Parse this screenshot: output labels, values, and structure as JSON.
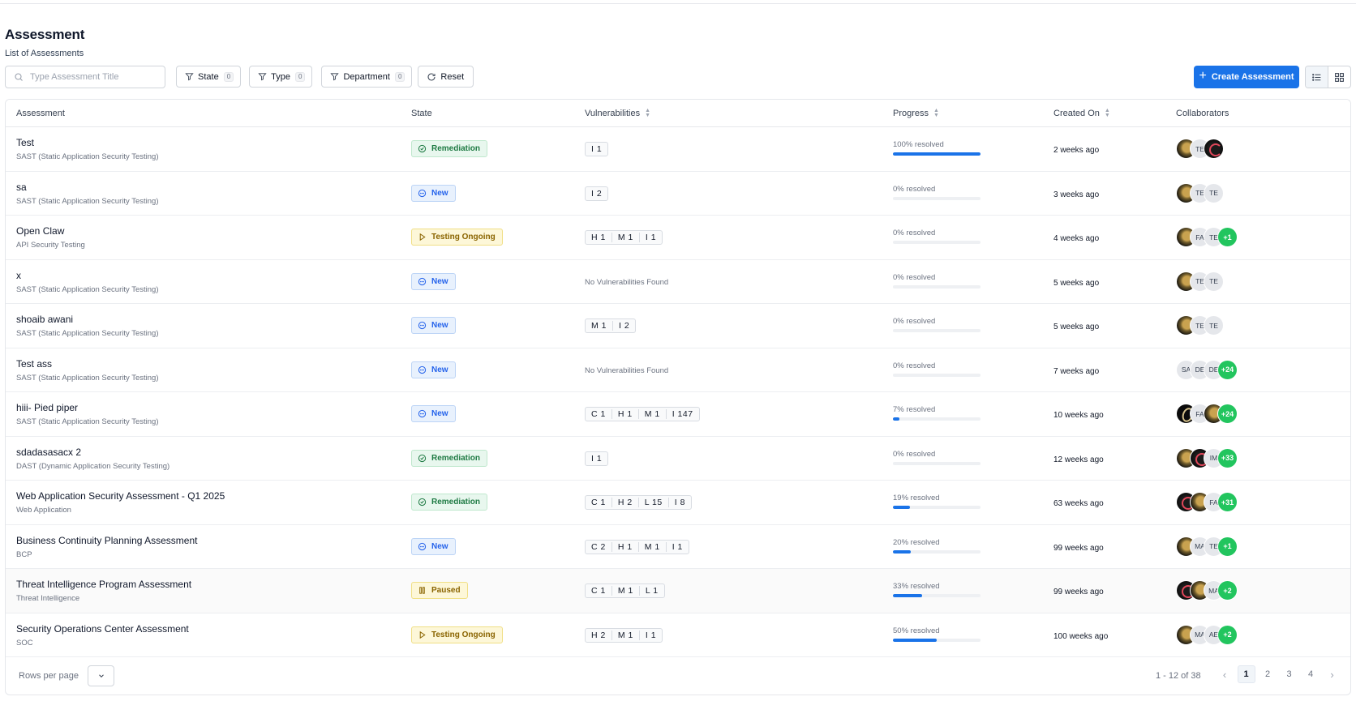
{
  "page": {
    "title": "Assessment",
    "subtitle": "List of Assessments"
  },
  "toolbar": {
    "search_placeholder": "Type Assessment Title",
    "filters": [
      {
        "label": "State",
        "count": "0"
      },
      {
        "label": "Type",
        "count": "0"
      },
      {
        "label": "Department",
        "count": "0"
      }
    ],
    "reset_label": "Reset",
    "create_label": "Create Assessment"
  },
  "table": {
    "columns": [
      "Assessment",
      "State",
      "Vulnerabilities",
      "Progress",
      "Created On",
      "Collaborators"
    ],
    "no_vulns_text": "No Vulnerabilities Found",
    "rows": [
      {
        "title": "Test",
        "type": "SAST (Static Application Security Testing)",
        "state": "Remediation",
        "vulns": [
          "I 1"
        ],
        "progress_label": "100% resolved",
        "progress": 100,
        "created": "2 weeks ago",
        "collaborators": [
          {
            "kind": "img1"
          },
          {
            "kind": "ini",
            "text": "TE"
          },
          {
            "kind": "img2"
          }
        ]
      },
      {
        "title": "sa",
        "type": "SAST (Static Application Security Testing)",
        "state": "New",
        "vulns": [
          "I 2"
        ],
        "progress_label": "0% resolved",
        "progress": 0,
        "created": "3 weeks ago",
        "collaborators": [
          {
            "kind": "img1"
          },
          {
            "kind": "ini",
            "text": "TE"
          },
          {
            "kind": "ini",
            "text": "TE"
          }
        ]
      },
      {
        "title": "Open Claw",
        "type": "API Security Testing",
        "state": "Testing Ongoing",
        "vulns": [
          "H 1",
          "M 1",
          "I 1"
        ],
        "progress_label": "0% resolved",
        "progress": 0,
        "created": "4 weeks ago",
        "collaborators": [
          {
            "kind": "img1"
          },
          {
            "kind": "ini",
            "text": "FA"
          },
          {
            "kind": "ini",
            "text": "TE"
          },
          {
            "kind": "plus",
            "text": "+1"
          }
        ]
      },
      {
        "title": "x",
        "type": "SAST (Static Application Security Testing)",
        "state": "New",
        "vulns": [],
        "progress_label": "0% resolved",
        "progress": 0,
        "created": "5 weeks ago",
        "collaborators": [
          {
            "kind": "img1"
          },
          {
            "kind": "ini",
            "text": "TE"
          },
          {
            "kind": "ini",
            "text": "TE"
          }
        ]
      },
      {
        "title": "shoaib awani",
        "type": "SAST (Static Application Security Testing)",
        "state": "New",
        "vulns": [
          "M 1",
          "I 2"
        ],
        "progress_label": "0% resolved",
        "progress": 0,
        "created": "5 weeks ago",
        "collaborators": [
          {
            "kind": "img1"
          },
          {
            "kind": "ini",
            "text": "TE"
          },
          {
            "kind": "ini",
            "text": "TE"
          }
        ]
      },
      {
        "title": "Test ass",
        "type": "SAST (Static Application Security Testing)",
        "state": "New",
        "vulns": [],
        "progress_label": "0% resolved",
        "progress": 0,
        "created": "7 weeks ago",
        "collaborators": [
          {
            "kind": "ini",
            "text": "SA"
          },
          {
            "kind": "ini",
            "text": "DE"
          },
          {
            "kind": "ini",
            "text": "DE"
          },
          {
            "kind": "plus",
            "text": "+24"
          }
        ]
      },
      {
        "title": "hiii- Pied piper",
        "type": "SAST (Static Application Security Testing)",
        "state": "New",
        "vulns": [
          "C 1",
          "H 1",
          "M 1",
          "I 147"
        ],
        "progress_label": "7% resolved",
        "progress": 7,
        "created": "10 weeks ago",
        "collaborators": [
          {
            "kind": "img3"
          },
          {
            "kind": "ini",
            "text": "FA"
          },
          {
            "kind": "img1"
          },
          {
            "kind": "plus",
            "text": "+24"
          }
        ]
      },
      {
        "title": "sdadasasacx 2",
        "type": "DAST (Dynamic Application Security Testing)",
        "state": "Remediation",
        "vulns": [
          "I 1"
        ],
        "progress_label": "0% resolved",
        "progress": 0,
        "created": "12 weeks ago",
        "collaborators": [
          {
            "kind": "img1"
          },
          {
            "kind": "img2"
          },
          {
            "kind": "ini",
            "text": "IM"
          },
          {
            "kind": "plus",
            "text": "+33"
          }
        ]
      },
      {
        "title": "Web Application Security Assessment - Q1 2025",
        "type": "Web Application",
        "state": "Remediation",
        "vulns": [
          "C 1",
          "H 2",
          "L 15",
          "I 8"
        ],
        "progress_label": "19% resolved",
        "progress": 19,
        "created": "63 weeks ago",
        "collaborators": [
          {
            "kind": "img2"
          },
          {
            "kind": "img1"
          },
          {
            "kind": "ini",
            "text": "FA"
          },
          {
            "kind": "plus",
            "text": "+31"
          }
        ]
      },
      {
        "title": "Business Continuity Planning Assessment",
        "type": "BCP",
        "state": "New",
        "vulns": [
          "C 2",
          "H 1",
          "M 1",
          "I 1"
        ],
        "progress_label": "20% resolved",
        "progress": 20,
        "created": "99 weeks ago",
        "collaborators": [
          {
            "kind": "img1"
          },
          {
            "kind": "ini",
            "text": "MA"
          },
          {
            "kind": "ini",
            "text": "TE"
          },
          {
            "kind": "plus",
            "text": "+1"
          }
        ]
      },
      {
        "title": "Threat Intelligence Program Assessment",
        "type": "Threat Intelligence",
        "state": "Paused",
        "vulns": [
          "C 1",
          "M 1",
          "L 1"
        ],
        "progress_label": "33% resolved",
        "progress": 33,
        "created": "99 weeks ago",
        "collaborators": [
          {
            "kind": "img2"
          },
          {
            "kind": "img1"
          },
          {
            "kind": "ini",
            "text": "MA"
          },
          {
            "kind": "plus",
            "text": "+2"
          }
        ]
      },
      {
        "title": "Security Operations Center Assessment",
        "type": "SOC",
        "state": "Testing Ongoing",
        "vulns": [
          "H 2",
          "M 1",
          "I 1"
        ],
        "progress_label": "50% resolved",
        "progress": 50,
        "created": "100 weeks ago",
        "collaborators": [
          {
            "kind": "img1"
          },
          {
            "kind": "ini",
            "text": "MA"
          },
          {
            "kind": "ini",
            "text": "AE"
          },
          {
            "kind": "plus",
            "text": "+2"
          }
        ]
      }
    ]
  },
  "footer": {
    "rows_per_page_label": "Rows per page",
    "range": "1 - 12 of 38",
    "pages": [
      "1",
      "2",
      "3",
      "4"
    ],
    "current_page": "1",
    "prev_icon": "‹",
    "next_icon": "›"
  },
  "colors": {
    "accent": "#1a73e8",
    "success": "#22c55e",
    "state_green": "#1e7a43",
    "state_blue": "#2563eb",
    "state_yellow": "#8a6400"
  }
}
